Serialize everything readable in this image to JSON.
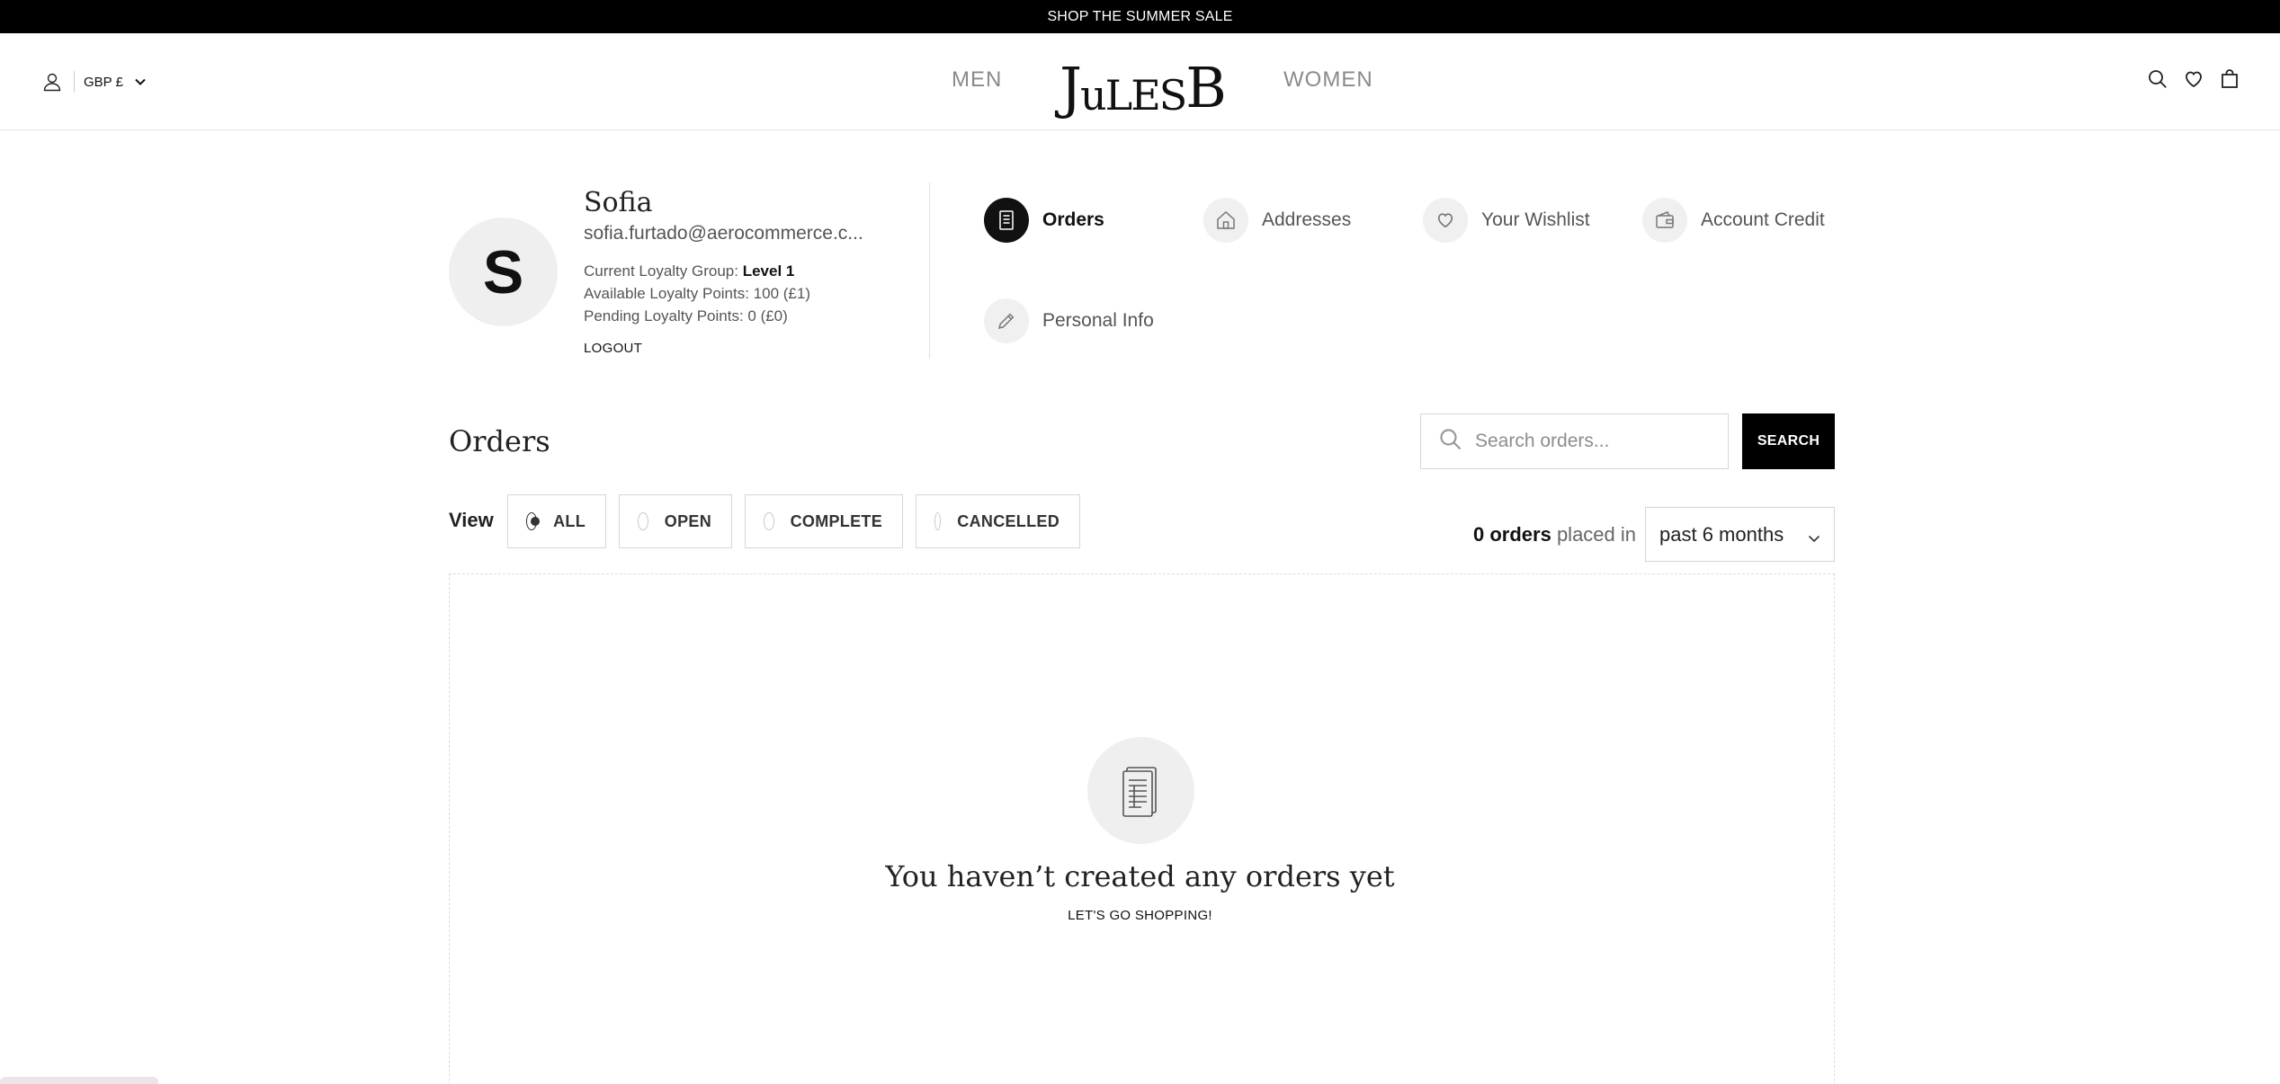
{
  "announcement": "SHOP THE SUMMER SALE",
  "header": {
    "currency": "GBP £",
    "nav_left": "MEN",
    "nav_right": "WOMEN",
    "logo": {
      "J": "J",
      "ules": "uLES",
      "B": "B"
    },
    "icons": [
      "user-icon",
      "chevron-down-icon",
      "search-icon",
      "heart-icon",
      "bag-icon"
    ]
  },
  "account": {
    "initial": "S",
    "name": "Sofia",
    "email": "sofia.furtado@aerocommerce.c...",
    "loyalty_group_label": "Current Loyalty Group: ",
    "loyalty_group_value": "Level 1",
    "available_points": "Available Loyalty Points: 100 (£1)",
    "pending_points": "Pending Loyalty Points: 0 (£0)",
    "logout": "LOGOUT"
  },
  "account_nav": [
    {
      "label": "Orders",
      "icon": "receipt-icon",
      "active": true
    },
    {
      "label": "Addresses",
      "icon": "home-icon",
      "active": false
    },
    {
      "label": "Your Wishlist",
      "icon": "heart-icon",
      "active": false
    },
    {
      "label": "Account Credit",
      "icon": "wallet-icon",
      "active": false
    },
    {
      "label": "Personal Info",
      "icon": "pencil-icon",
      "active": false
    }
  ],
  "orders": {
    "title": "Orders",
    "search_placeholder": "Search orders...",
    "search_button": "SEARCH",
    "view_label": "View",
    "filters": [
      {
        "label": "ALL",
        "selected": true
      },
      {
        "label": "OPEN",
        "selected": false
      },
      {
        "label": "COMPLETE",
        "selected": false
      },
      {
        "label": "CANCELLED",
        "selected": false
      }
    ],
    "count_bold": "0 orders",
    "count_suffix": " placed in",
    "period": "past 6 months",
    "empty_title": "You haven’t created any orders yet",
    "empty_cta": "LET'S GO SHOPPING!"
  },
  "colors": {
    "accent": "#000000",
    "muted": "#8a8a8a",
    "icon_bg": "#f0f0f0"
  }
}
